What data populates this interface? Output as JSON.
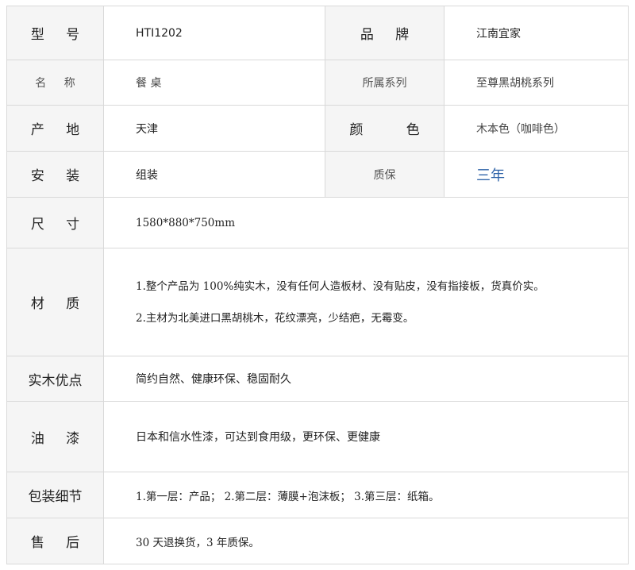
{
  "rows": [
    {
      "label_a": "型",
      "label_b": "号",
      "value": "HTI1202",
      "label2": "品",
      "label2_b": "牌",
      "value2": "江南宜家"
    },
    {
      "label_a": "名",
      "label_b": "称",
      "value": "餐 桌",
      "label2": "所属系列",
      "value2": "至尊黑胡桃系列"
    },
    {
      "label_a": "产",
      "label_b": "地",
      "value": "天津",
      "label2_a": "颜",
      "label2_b": "色",
      "value2": "木本色（咖啡色）"
    },
    {
      "label_a": "安",
      "label_b": "装",
      "value": "组装",
      "label2": "质保",
      "value2": "三年"
    },
    {
      "label_a": "尺",
      "label_b": "寸",
      "value": "1580*880*750mm"
    },
    {
      "label_a": "材",
      "label_b": "质",
      "lines": [
        "1.整个产品为 100%纯实木，没有任何人造板材、没有贴皮，没有指接板，货真价实。",
        "2.主材为北美进口黑胡桃木，花纹漂亮，少结疤，无霉变。"
      ]
    },
    {
      "label": "实木优点",
      "value": "简约自然、健康环保、稳固耐久"
    },
    {
      "label_a": "油",
      "label_b": "漆",
      "value": "日本和信水性漆，可达到食用级，更环保、更健康"
    },
    {
      "label": "包装细节",
      "value": "1.第一层：产品； 2.第二层：薄膜+泡沫板； 3.第三层：纸箱。"
    },
    {
      "label_a": "售",
      "label_b": "后",
      "value": "30 天退换货，3 年质保。"
    }
  ],
  "colors": {
    "label_bg": "#f5f5f5",
    "border": "#d9d9d9",
    "accent": "#3366aa"
  }
}
